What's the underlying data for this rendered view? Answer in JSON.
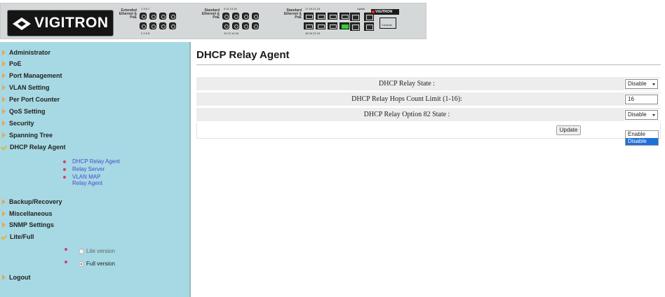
{
  "header": {
    "brand": "VIGITRON",
    "mini_brand": "VIGITRON",
    "group1_label": "Extended Ethernet & PoE",
    "group1_top_nums": "1   3   5   7",
    "group1_bottom_nums": "2   4   6   8",
    "group2_label": "Standard Ethernet & PoE",
    "group2_top_nums": "9   11  13  15",
    "group2_bottom_nums": "10  12  14  16",
    "group3_label": "Standard Ethernet & PoE",
    "group3_top_nums": "17  19  21  23",
    "group3_bottom_nums": "18  20  22  24",
    "uplink_label": "Uplink",
    "console_label": "Console"
  },
  "sidebar": {
    "items": [
      {
        "label": "Administrator",
        "icon": "triangle-right-icon"
      },
      {
        "label": "PoE",
        "icon": "triangle-right-icon"
      },
      {
        "label": "Port Management",
        "icon": "triangle-right-icon"
      },
      {
        "label": "VLAN Setting",
        "icon": "triangle-right-icon"
      },
      {
        "label": "Per Port Counter",
        "icon": "triangle-right-icon"
      },
      {
        "label": "QoS Setting",
        "icon": "triangle-right-icon"
      },
      {
        "label": "Security",
        "icon": "triangle-right-icon"
      },
      {
        "label": "Spanning Tree",
        "icon": "triangle-right-icon"
      },
      {
        "label": "DHCP Relay Agent",
        "icon": "check-icon"
      },
      {
        "label": "Backup/Recovery",
        "icon": "triangle-right-icon"
      },
      {
        "label": "Miscellaneous",
        "icon": "triangle-right-icon"
      },
      {
        "label": "SNMP Settings",
        "icon": "triangle-right-icon"
      },
      {
        "label": "Lite/Full",
        "icon": "check-icon"
      },
      {
        "label": "Logout",
        "icon": "triangle-right-icon"
      }
    ],
    "dhcp_sub": [
      {
        "label": "DHCP Relay Agent"
      },
      {
        "label": "Relay Server"
      },
      {
        "label": "VLAN MAP Relay Agent"
      }
    ],
    "version": {
      "lite_label": "Lite version",
      "full_label": "Full version",
      "selected": "Full version"
    }
  },
  "main": {
    "title": "DHCP Relay Agent",
    "rows": [
      {
        "label": "DHCP Relay State :",
        "value": "Disable"
      },
      {
        "label": "DHCP Relay Hops Count Limit (1-16):",
        "value": "16"
      },
      {
        "label": "DHCP Relay Option 82 State :",
        "value": "Disable"
      }
    ],
    "update_label": "Update",
    "option82_dropdown": {
      "options": [
        "Enable",
        "Disable"
      ],
      "highlighted": "Disable"
    }
  },
  "colors": {
    "sidebar_bg": "#a6d9e3",
    "row_bg": "#ededed",
    "link": "#4a4ad0",
    "dropdown_highlight": "#1f6fd6",
    "active_port": "#2fd12f"
  }
}
